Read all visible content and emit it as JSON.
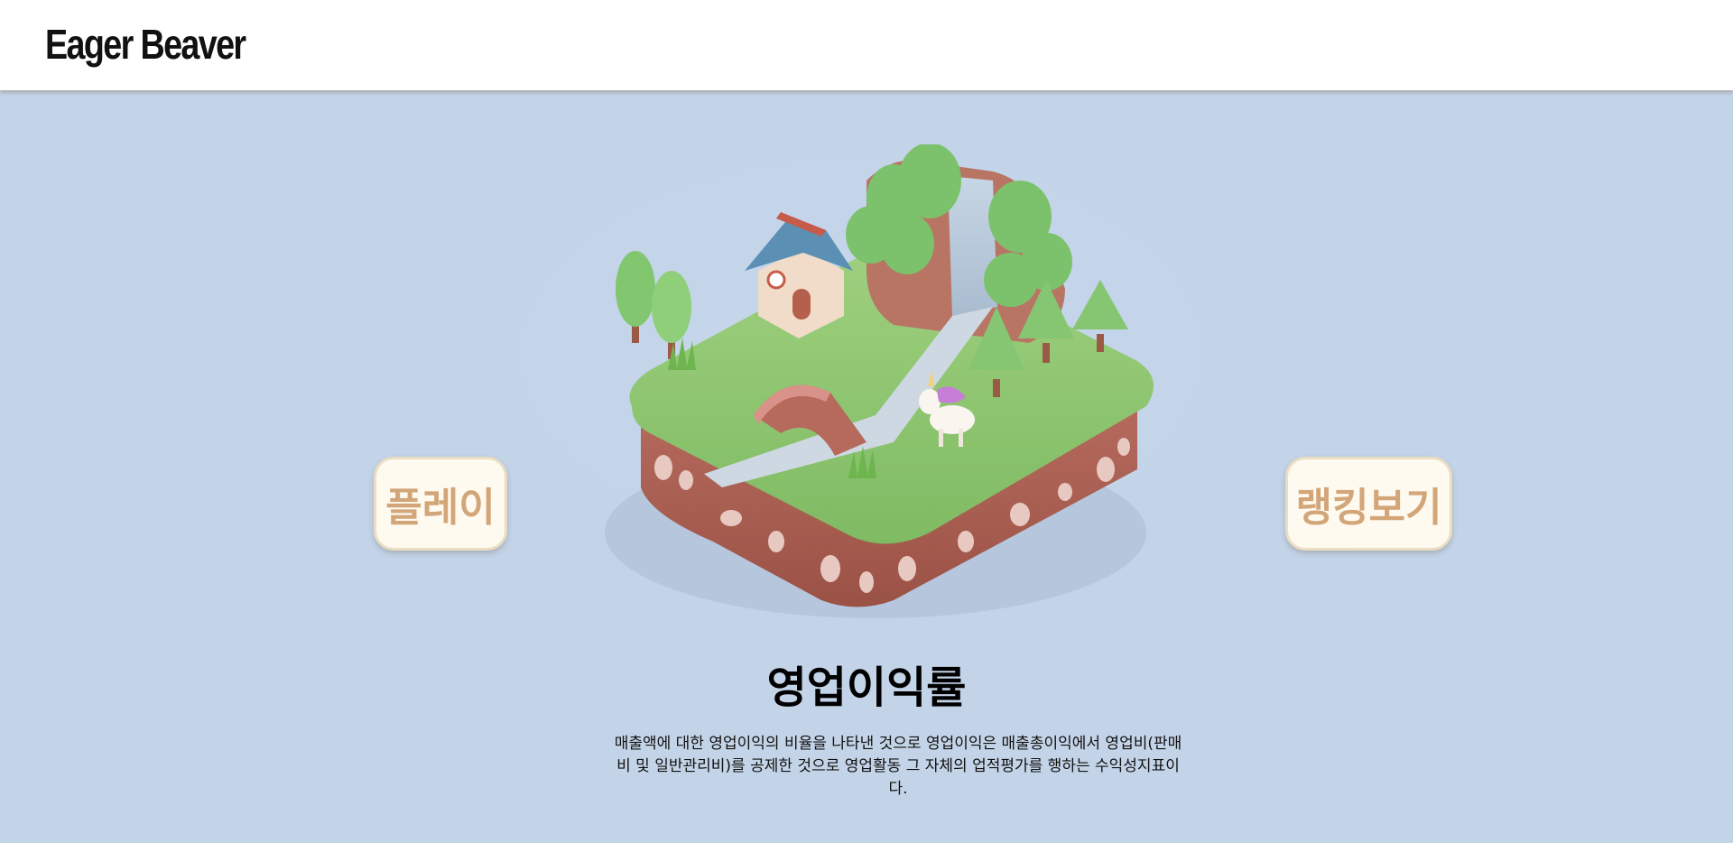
{
  "header": {
    "logo": "Eager Beaver"
  },
  "main": {
    "play_label": "플레이",
    "ranking_label": "랭킹보기",
    "term_title": "영업이익률",
    "term_description": "매출액에 대한 영업이익의 비율을 나타낸 것으로 영업이익은 매출총이익에서 영업비(판매비 및 일반관리비)를 공제한 것으로 영업활동 그 자체의 업적평가를 행하는 수익성지표이다."
  },
  "colors": {
    "background": "#c4d4e8",
    "button_text": "#d2a679",
    "button_bg": "#fffaf0"
  }
}
